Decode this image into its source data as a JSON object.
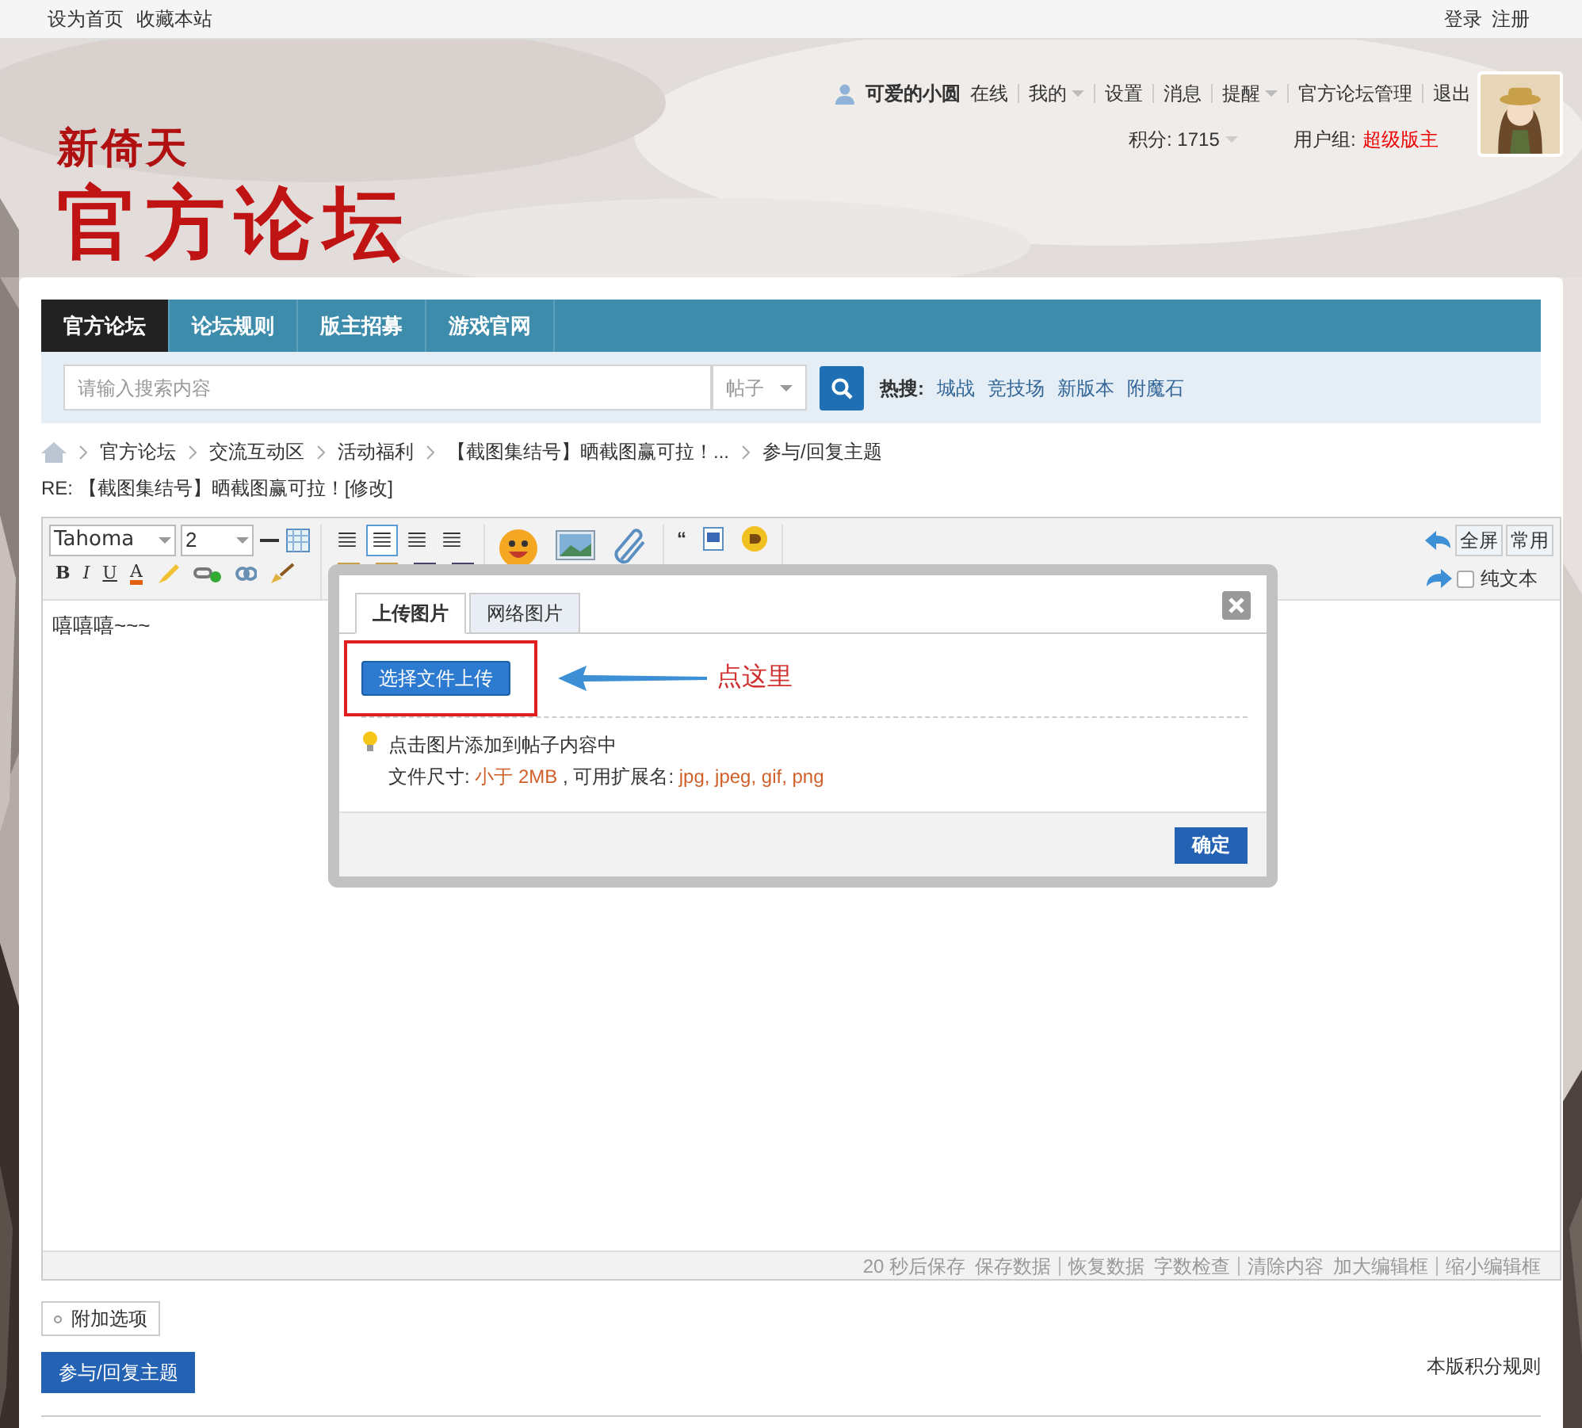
{
  "topbar": {
    "left_links": [
      "设为首页",
      "收藏本站"
    ],
    "right_links": [
      "登录",
      "注册"
    ]
  },
  "header": {
    "logo_small": "新倚天",
    "logo_big": "官方论坛",
    "user": {
      "name": "可爱的小圆",
      "status": "在线"
    },
    "menu": [
      {
        "label": "我的",
        "dropdown": true
      },
      {
        "label": "设置",
        "dropdown": false
      },
      {
        "label": "消息",
        "dropdown": false
      },
      {
        "label": "提醒",
        "dropdown": true
      },
      {
        "label": "官方论坛管理",
        "dropdown": false
      },
      {
        "label": "退出",
        "dropdown": false
      }
    ],
    "points": "积分: 1715",
    "group_label": "用户组:",
    "group": "超级版主"
  },
  "nav": [
    {
      "label": "官方论坛",
      "selected": true
    },
    {
      "label": "论坛规则",
      "selected": false
    },
    {
      "label": "版主招募",
      "selected": false
    },
    {
      "label": "游戏官网",
      "selected": false
    }
  ],
  "search": {
    "placeholder": "请输入搜索内容",
    "scope": "帖子",
    "hot_label": "热搜:",
    "hot": [
      "城战",
      "竞技场",
      "新版本",
      "附魔石"
    ]
  },
  "breadcrumb": [
    "官方论坛",
    "交流互动区",
    "活动福利",
    "【截图集结号】晒截图赢可拉！...",
    "参与/回复主题"
  ],
  "post_title": "RE: 【截图集结号】晒截图赢可拉！[修改]",
  "editor": {
    "font": "Tahoma",
    "size": "2",
    "format_buttons": [
      "B",
      "I",
      "U",
      "A"
    ],
    "quote_button": "“",
    "right_buttons": [
      "全屏",
      "常用"
    ],
    "plain_text": {
      "label": "纯文本",
      "checked": false
    },
    "content": "嘻嘻嘻~~~",
    "status": [
      "20 秒后保存",
      "保存数据",
      "恢复数据",
      "字数检查",
      "清除内容",
      "加大编辑框",
      "缩小编辑框"
    ]
  },
  "dialog": {
    "tabs": [
      {
        "label": "上传图片",
        "selected": true
      },
      {
        "label": "网络图片",
        "selected": false
      }
    ],
    "upload_button": "选择文件上传",
    "annotation": "点这里",
    "hint": "点击图片添加到帖子内容中",
    "size_label": "文件尺寸: ",
    "size": "小于 2MB",
    "ext_label": " , 可用扩展名: ",
    "ext": "jpg, jpeg, gif, png",
    "confirm": "确定"
  },
  "options_button": "附加选项",
  "submit_button": "参与/回复主题",
  "rules_link": "本版积分规则"
}
